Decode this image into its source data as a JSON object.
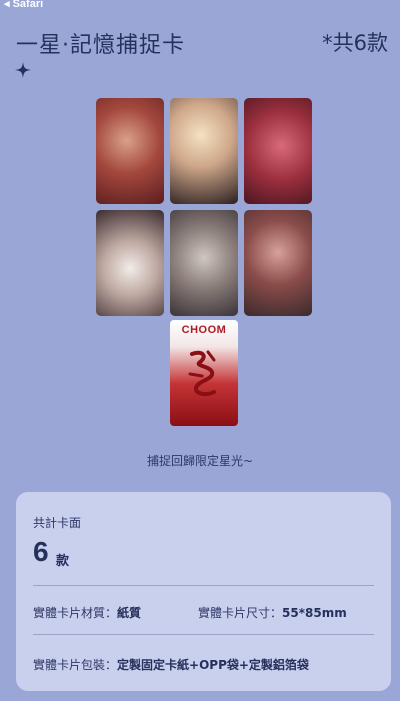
{
  "status_bar": {
    "back_label": "◂ Safari"
  },
  "header": {
    "title": "一星·記憶捕捉卡",
    "count": "*共6款"
  },
  "icons": {
    "sparkle": "four-point-star-icon"
  },
  "cards": [
    {
      "name": "photocard-1"
    },
    {
      "name": "photocard-2"
    },
    {
      "name": "photocard-3"
    },
    {
      "name": "photocard-4"
    },
    {
      "name": "photocard-5"
    },
    {
      "name": "photocard-6"
    }
  ],
  "special_card": {
    "brand": "CHOOM"
  },
  "caption": "捕捉回歸限定星光~",
  "info": {
    "total_label": "共計卡面",
    "total_value": "6",
    "total_unit": "款",
    "material_label": "實體卡片材質：",
    "material_value": "紙質",
    "size_label": "實體卡片尺寸：",
    "size_value": "55*85mm",
    "package_label": "實體卡片包裝：",
    "package_value": "定製固定卡紙+OPP袋+定製鋁箔袋"
  },
  "colors": {
    "background": "#9aa7d6",
    "panel": "#c9d0ee",
    "text": "#26305c"
  }
}
